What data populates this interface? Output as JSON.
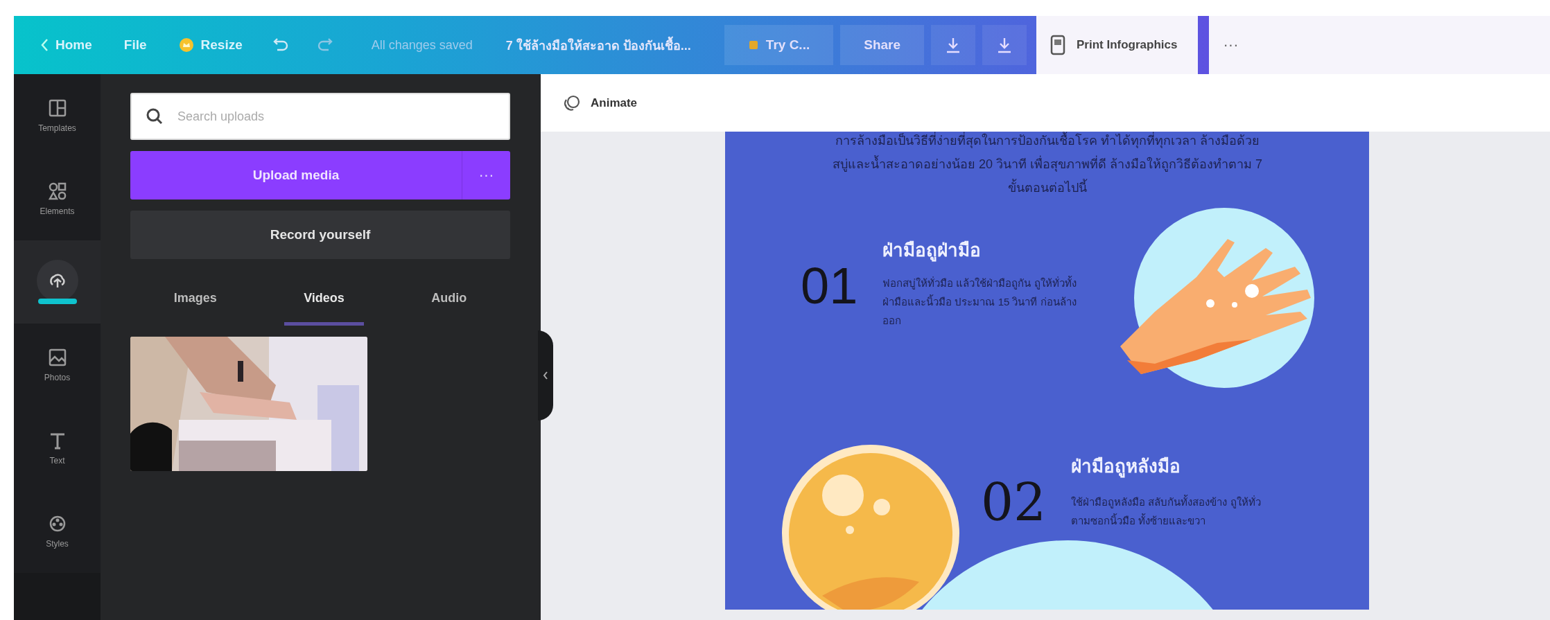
{
  "topbar": {
    "home": "Home",
    "file": "File",
    "resize": "Resize",
    "saved_status": "All changes saved",
    "doc_title": "7 ใช้ล้างมือให้สะอาด ป้องกันเชื้อ...",
    "try_button": "Try C...",
    "share": "Share",
    "print_button": "Print Infographics",
    "more": "···"
  },
  "rail": {
    "items": [
      {
        "label": "Templates",
        "selected": false
      },
      {
        "label": "Elements",
        "selected": false
      },
      {
        "selected": true
      },
      {
        "label": "Photos",
        "selected": false
      },
      {
        "label": "Text",
        "selected": false
      },
      {
        "label": "Styles",
        "selected": false
      }
    ]
  },
  "panel": {
    "search": {
      "placeholder": "Search uploads"
    },
    "upload_button": "Upload media",
    "upload_more": "···",
    "record_button": "Record yourself",
    "tabs": [
      {
        "label": "Images",
        "selected": false
      },
      {
        "label": "Videos",
        "selected": true
      },
      {
        "label": "Audio",
        "selected": false
      }
    ]
  },
  "toolbar": {
    "animate": "Animate"
  },
  "design": {
    "intro": "การล้างมือเป็นวิธีที่ง่ายที่สุดในการป้องกันเชื้อโรค ทำได้ทุกที่ทุกเวลา ล้างมือด้วยสบู่และน้ำสะอาดอย่างน้อย 20 วินาที เพื่อสุขภาพที่ดี ล้างมือให้ถูกวิธีต้องทำตาม 7 ขั้นตอนต่อไปนี้",
    "steps": [
      {
        "number": "01",
        "heading": "ฝ่ามือถูฝ่ามือ",
        "body": "ฟอกสบู่ให้ทั่วมือ แล้วใช้ฝ่ามือถูกัน ถูให้ทั่วทั้งฝ่ามือและนิ้วมือ ประมาณ 15 วินาที ก่อนล้างออก"
      },
      {
        "number": "02",
        "heading": "ฝ่ามือถูหลังมือ",
        "body": "ใช้ฝ่ามือถูหลังมือ สลับกันทั้งสองข้าง ถูให้ทั่วตามซอกนิ้วมือ ทั้งซ้ายและขวา"
      }
    ]
  }
}
